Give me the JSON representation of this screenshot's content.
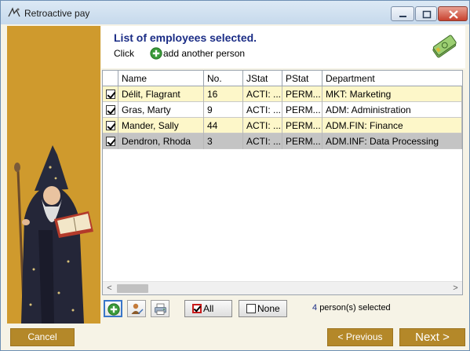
{
  "window": {
    "title": "Retroactive pay",
    "app_icon": "signature-icon",
    "controls": [
      "minimize-icon",
      "maximize-icon",
      "close-icon"
    ]
  },
  "header": {
    "title": "List of employees selected.",
    "click_label": "Click",
    "add_label": "add another person",
    "add_icon": "plus-circle-icon",
    "badge_icon": "money-stack-icon"
  },
  "table": {
    "columns": [
      "",
      "Name",
      "No.",
      "JStat",
      "PStat",
      "Department"
    ],
    "rows": [
      {
        "checked": true,
        "name": "Délit, Flagrant",
        "no": "16",
        "jstat": "ACTI: ...",
        "pstat": "PERM...",
        "department": "MKT: Marketing",
        "style": "highlight"
      },
      {
        "checked": true,
        "name": "Gras, Marty",
        "no": "9",
        "jstat": "ACTI: ...",
        "pstat": "PERM...",
        "department": "ADM: Administration",
        "style": "plain"
      },
      {
        "checked": true,
        "name": "Mander, Sally",
        "no": "44",
        "jstat": "ACTI: ...",
        "pstat": "PERM...",
        "department": "ADM.FIN: Finance",
        "style": "highlight"
      },
      {
        "checked": true,
        "name": "Dendron, Rhoda",
        "no": "3",
        "jstat": "ACTI: ...",
        "pstat": "PERM...",
        "department": "ADM.INF: Data Processing",
        "style": "selected"
      }
    ],
    "scroll_left": "<",
    "scroll_right": ">"
  },
  "toolbar": {
    "add_icon": "plus-circle-icon",
    "person_icon": "person-edit-icon",
    "print_icon": "printer-icon",
    "all_label": "All",
    "none_label": "None",
    "count_value": "4",
    "count_label": "person(s) selected"
  },
  "footer": {
    "cancel_label": "Cancel",
    "previous_label": "< Previous",
    "next_label": "Next >"
  },
  "colors": {
    "accent_gold": "#cf9a2d",
    "button_gold": "#b48829",
    "title_blue": "#1b2d86",
    "row_highlight": "#fdf7c9",
    "row_selected": "#c4c4c4",
    "add_green": "#3a9a3a"
  }
}
